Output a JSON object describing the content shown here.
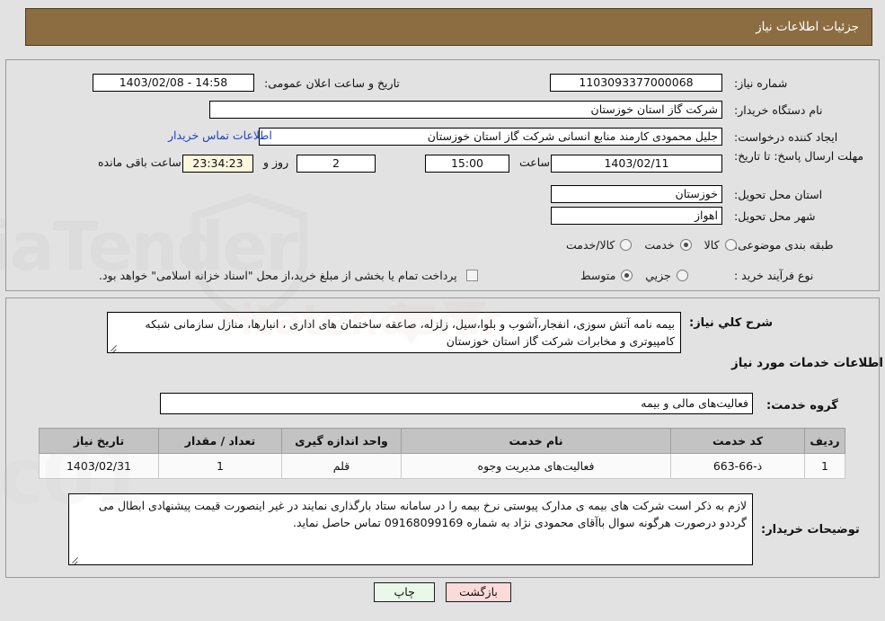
{
  "header": {
    "title": "جزئیات اطلاعات نیاز"
  },
  "fields": {
    "need_number": {
      "label": "شماره نیاز:",
      "value": "1103093377000068"
    },
    "public_announce": {
      "label": "تاریخ و ساعت اعلان عمومی:",
      "value": "14:58 - 1403/02/08"
    },
    "buyer_org": {
      "label": "نام دستگاه خریدار:",
      "value": "شرکت گاز استان خوزستان"
    },
    "requester": {
      "label": "ایجاد کننده درخواست:",
      "value": "جلیل محمودی کارمند منابع انسانی شرکت گاز استان خوزستان"
    },
    "buyer_contact_link": "اطلاعات تماس خریدار",
    "deadline": {
      "label": "مهلت ارسال پاسخ: تا تاریخ:",
      "date": "1403/02/11",
      "time_label": "ساعت",
      "time": "15:00",
      "days": "2",
      "days_label": "روز و",
      "countdown": "23:34:23",
      "countdown_label": "ساعت باقی مانده"
    },
    "province": {
      "label": "استان محل تحویل:",
      "value": "خوزستان"
    },
    "city": {
      "label": "شهر محل تحویل:",
      "value": "اهواز"
    },
    "category": {
      "label": "طبقه بندی موضوعی:",
      "options": [
        {
          "label": "کالا",
          "selected": false
        },
        {
          "label": "خدمت",
          "selected": true
        },
        {
          "label": "کالا/خدمت",
          "selected": false
        }
      ]
    },
    "process_type": {
      "label": "نوع فرآیند خرید :",
      "options": [
        {
          "label": "جزیي",
          "selected": false
        },
        {
          "label": "متوسط",
          "selected": true
        }
      ],
      "checkbox_label": "پرداخت تمام یا بخشی از مبلغ خرید،از محل \"اسناد خزانه اسلامی\" خواهد بود.",
      "checkbox_checked": false
    }
  },
  "general_description": {
    "label": "شرح کلي نیاز:",
    "value": "بیمه نامه آتش سوزی، انفجار،آشوب و بلوا،سیل، زلزله، صاعقه ساختمان های اداری ، انبارها، منازل سازمانی شبکه کامپیوتری و مخابرات شرکت گاز استان خوزستان"
  },
  "services_section": {
    "heading": "اطلاعات خدمات مورد نیاز",
    "service_group": {
      "label": "گروه خدمت:",
      "value": "فعالیت‌های مالی و بیمه"
    },
    "table": {
      "columns": [
        "ردیف",
        "کد خدمت",
        "نام خدمت",
        "واحد اندازه گیری",
        "تعداد / مقدار",
        "تاریخ نیاز"
      ],
      "rows": [
        {
          "row": "1",
          "code": "ذ-66-663",
          "name": "فعالیت‌های مدیریت وجوه",
          "unit": "قلم",
          "quantity": "1",
          "need_date": "1403/02/31"
        }
      ]
    }
  },
  "buyer_notes": {
    "label": "توضیحات خریدار:",
    "value": "لازم به ذکر است شرکت های بیمه ی مدارک پیوستی نرخ بیمه را در سامانه ستاد بارگذاری نمایند در غیر اینصورت قیمت پیشنهادی ابطال می گرددو درصورت هرگونه سوال باآقای محمودی نژاد به شماره 09168099169 تماس حاصل نماید."
  },
  "footer": {
    "print_label": "چاپ",
    "back_label": "بازگشت"
  },
  "colors": {
    "header_brown": "#8c6d41",
    "page_bg": "#e2e2e2",
    "link_blue": "#1b3fd0",
    "table_header_gray": "#c3c3c3",
    "print_button_bg": "#e9f8e9",
    "back_button_bg": "#fbdada",
    "countdown_bg": "#fbf7dd"
  }
}
